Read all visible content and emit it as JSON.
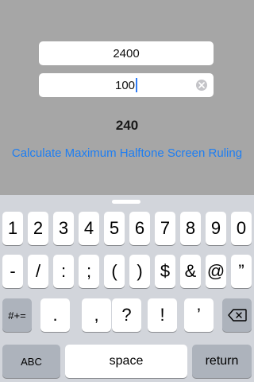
{
  "form": {
    "resolution_value": "2400",
    "levels_value": "100",
    "result": "240",
    "action_label": "Calculate Maximum Halftone Screen Ruling"
  },
  "keyboard": {
    "row1": [
      "1",
      "2",
      "3",
      "4",
      "5",
      "6",
      "7",
      "8",
      "9",
      "0"
    ],
    "row2": [
      "-",
      "/",
      ":",
      ";",
      "(",
      ")",
      "$",
      "&",
      "@",
      "”"
    ],
    "row3_left": "#+=",
    "row3": [
      ".",
      ",",
      "?",
      "!",
      "’"
    ],
    "abc_label": "ABC",
    "space_label": "space",
    "return_label": "return"
  },
  "colors": {
    "background": "#a6a6a6",
    "accent": "#1e7ef2",
    "keyboard_bg": "#d2d5db"
  },
  "icons": {
    "clear": "x-circle-icon",
    "delete": "backspace-icon"
  }
}
